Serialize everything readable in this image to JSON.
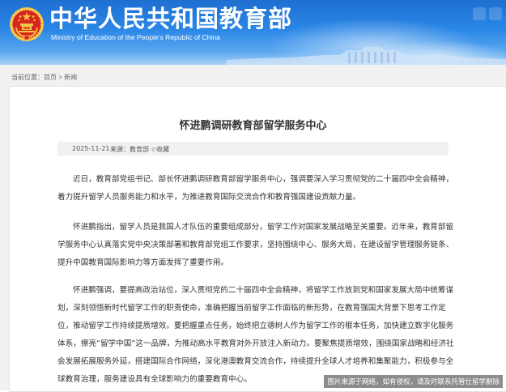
{
  "header": {
    "title_cn": "中华人民共和国教育部",
    "title_en": "Ministry of Education of the People's Republic of China"
  },
  "breadcrumb": {
    "label": "当前位置：",
    "items": [
      "首页",
      "新闻"
    ],
    "separator": ">"
  },
  "article": {
    "title": "怀进鹏调研教育部留学服务中心",
    "date": "2025-11-21",
    "source": "来源：教育部",
    "favorite": "收藏",
    "paragraphs": [
      "近日，教育部党组书记、部长怀进鹏调研教育部留学服务中心，强调要深入学习贯彻党的二十届四中全会精神，着力提升留学人员服务能力和水平，为推进教育国际交流合作和教育强国建设贡献力量。",
      "怀进鹏指出，留学人员是我国人才队伍的重要组成部分，留学工作对国家发展战略至关重要。近年来，教育部留学服务中心认真落实党中央决策部署和教育部党组工作要求，坚持围绕中心、服务大局，在建设留学管理服务链条、提升中国教育国际影响力等方面发挥了重要作用。",
      "怀进鹏强调，要提高政治站位，深入贯彻党的二十届四中全会精神，将留学工作放到党和国家发展大局中统筹谋划，深刻领悟新时代留学工作的职责使命，准确把握当前留学工作面临的新形势，在教育强国大背景下思考工作定位，推动留学工作持续提质增效。要把握重点任务，始终把立德树人作为留学工作的根本任务，加快建立数字化服务体系，擦亮“留学中国”这一品牌，为推动高水平教育对外开放注入新动力。要聚焦提质增效，围绕国家战略和经济社会发展拓展服务外延，搭建国际合作网络，深化港澳教育交流合作，持续提升全球人才培养和集聚能力，积极参与全球教育治理，服务建设具有全球影响力的重要教育中心。"
    ]
  },
  "image_caption": "图片来源于网络，如有侵权，请及时联系托管仕留学删除",
  "colors": {
    "header_blue": "#1e6fd0",
    "emblem_red": "#d8261f",
    "emblem_gold": "#f3c744",
    "text": "#333333"
  }
}
